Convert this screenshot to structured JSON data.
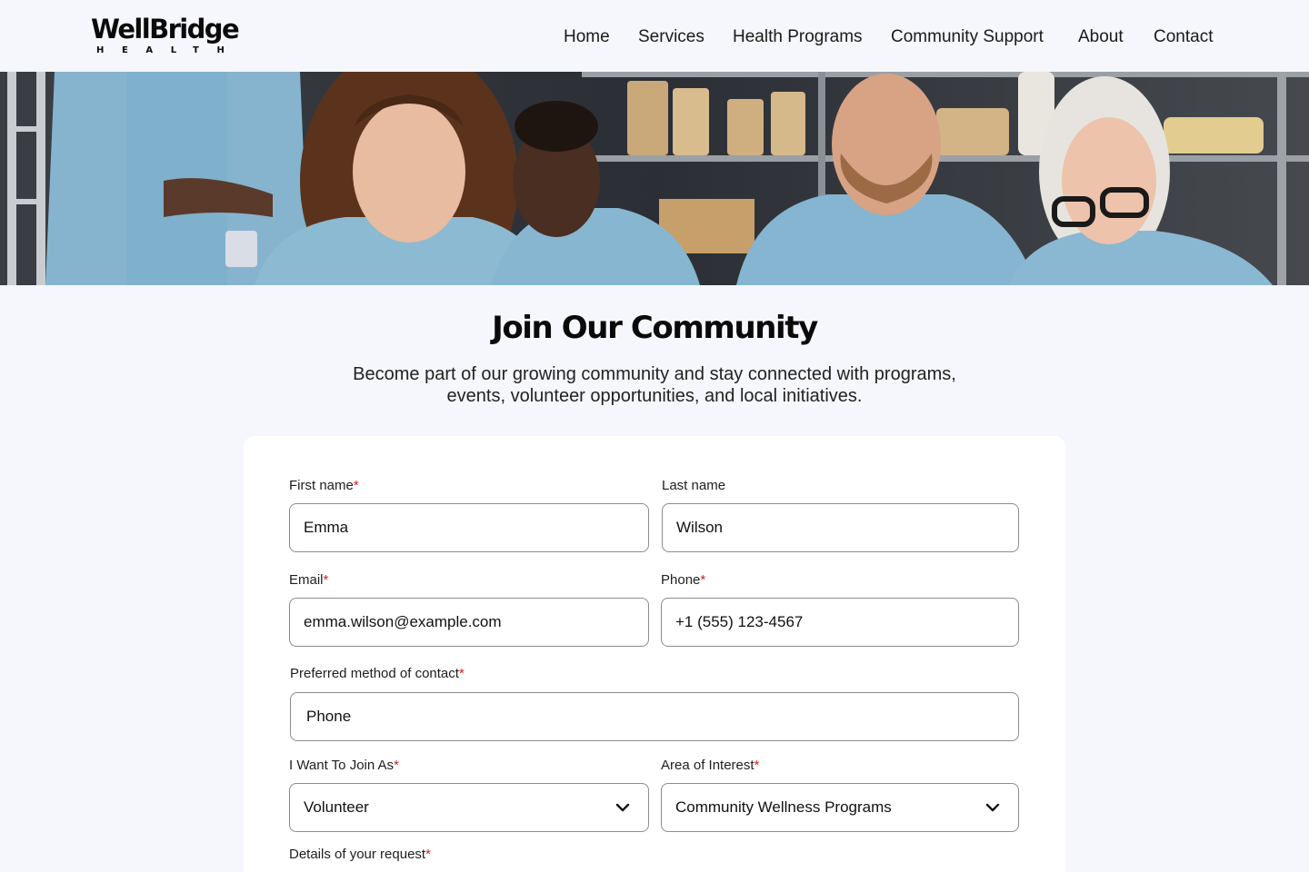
{
  "brand": {
    "name": "WellBridge",
    "tagline": "HEALTH"
  },
  "nav": {
    "items": [
      "Home",
      "Services",
      "Health Programs",
      "Community Support",
      "About",
      "Contact"
    ]
  },
  "hero": {
    "image": "volunteers-in-food-bank-photo"
  },
  "page": {
    "title": "Join Our Community",
    "subtitle_line1": "Become part of our growing community and stay connected with programs,",
    "subtitle_line2": "events, volunteer opportunities, and local initiatives."
  },
  "form": {
    "required_marker": "*",
    "first_name": {
      "label": "First name",
      "value": "Emma"
    },
    "last_name": {
      "label": "Last name",
      "value": "Wilson"
    },
    "email": {
      "label": "Email",
      "value": "emma.wilson@example.com"
    },
    "phone": {
      "label": "Phone",
      "value": "+1 (555) 123-4567"
    },
    "contact_method": {
      "label": "Preferred method of contact",
      "value": "Phone"
    },
    "join_as": {
      "label": "I Want To Join As",
      "value": "Volunteer"
    },
    "interest": {
      "label": "Area of Interest",
      "value": "Community Wellness Programs"
    },
    "details": {
      "label": "Details of your request"
    }
  },
  "colors": {
    "background": "#f6f7fc",
    "card": "#ffffff",
    "required": "#d0241b",
    "border": "#8c8c8c"
  }
}
